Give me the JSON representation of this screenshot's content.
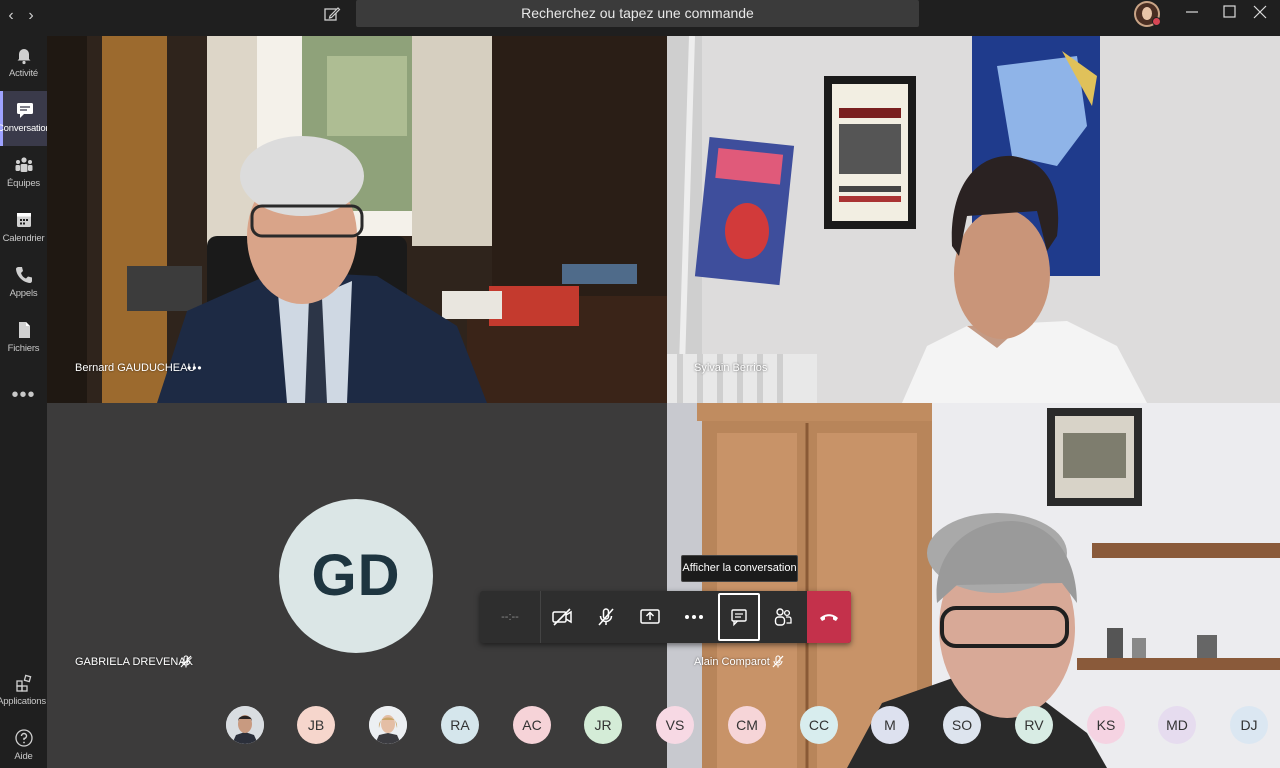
{
  "titlebar": {
    "search_placeholder": "Recherchez ou tapez une commande",
    "back_label": "‹",
    "forward_label": "›"
  },
  "sidebar": {
    "items": [
      {
        "label": "Activité",
        "icon": "bell-icon"
      },
      {
        "label": "Conversation",
        "icon": "chat-icon",
        "active": true
      },
      {
        "label": "Équipes",
        "icon": "teams-icon"
      },
      {
        "label": "Calendrier",
        "icon": "calendar-icon"
      },
      {
        "label": "Appels",
        "icon": "phone-icon"
      },
      {
        "label": "Fichiers",
        "icon": "files-icon"
      }
    ],
    "more_label": "•••",
    "bottom_items": [
      {
        "label": "Applications",
        "icon": "apps-icon"
      },
      {
        "label": "Aide",
        "icon": "help-icon"
      }
    ]
  },
  "meeting": {
    "participants_video": [
      {
        "name": "Bernard GAUDUCHEAU",
        "more": "•••"
      },
      {
        "name": "Sylvain Berrios"
      },
      {
        "name": "GABRIELA DREVENAK",
        "initials": "GD",
        "muted": true
      },
      {
        "name": "Alain Comparot",
        "muted": true
      }
    ],
    "controls": {
      "timer": "--:--",
      "tooltip": "Afficher la conversation",
      "selected": "show-conversation"
    },
    "roster": [
      {
        "initials": "",
        "type": "photo",
        "color": "#e2e6ea"
      },
      {
        "initials": "JB",
        "color": "#f6d6cc"
      },
      {
        "initials": "",
        "type": "photo",
        "color": "#e9ecef"
      },
      {
        "initials": "RA",
        "color": "#d5e6ec"
      },
      {
        "initials": "AC",
        "color": "#f6d3d8"
      },
      {
        "initials": "JR",
        "color": "#d4ecd7"
      },
      {
        "initials": "VS",
        "color": "#f7d9e4"
      },
      {
        "initials": "CM",
        "color": "#f6d5d8"
      },
      {
        "initials": "CC",
        "color": "#d8edee"
      },
      {
        "initials": "M",
        "color": "#dde1ef"
      },
      {
        "initials": "SO",
        "color": "#dde4ee"
      },
      {
        "initials": "RV",
        "color": "#d8ece4"
      },
      {
        "initials": "KS",
        "color": "#f5d3e2"
      },
      {
        "initials": "MD",
        "color": "#e6dcef"
      },
      {
        "initials": "DJ",
        "color": "#dbe7f2"
      }
    ]
  }
}
